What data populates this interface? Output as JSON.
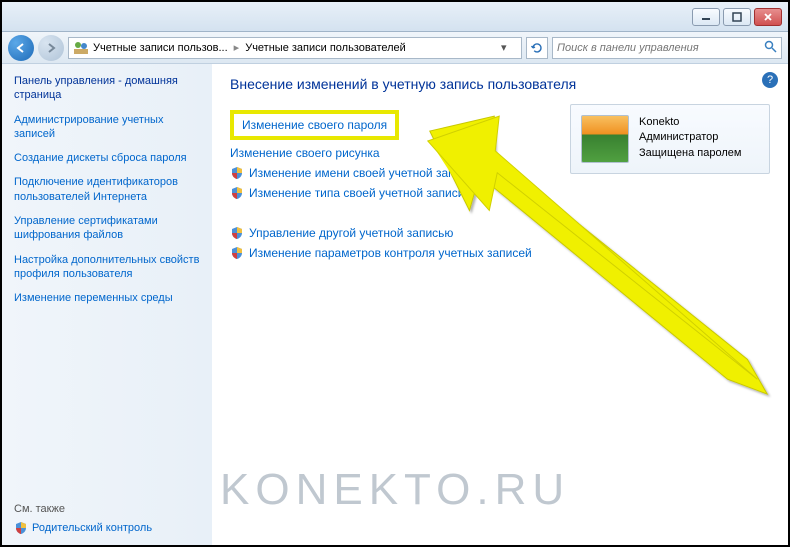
{
  "titlebar": {},
  "nav": {
    "breadcrumb_part1": "Учетные записи пользов...",
    "breadcrumb_part2": "Учетные записи пользователей",
    "search_placeholder": "Поиск в панели управления"
  },
  "sidebar": {
    "heading": "Панель управления - домашняя страница",
    "links": [
      "Администрирование учетных записей",
      "Создание дискеты сброса пароля",
      "Подключение идентификаторов пользователей Интернета",
      "Управление сертификатами шифрования файлов",
      "Настройка дополнительных свойств профиля пользователя",
      "Изменение переменных среды"
    ],
    "see_also_label": "См. также",
    "parental_label": "Родительский контроль"
  },
  "content": {
    "title": "Внесение изменений в учетную запись пользователя",
    "highlighted": "Изменение своего пароля",
    "links_plain": [
      "Изменение своего рисунка"
    ],
    "links_shield1": [
      "Изменение имени своей учетной зап",
      "Изменение типа своей учетной записи"
    ],
    "links_shield2": [
      "Управление другой учетной записью",
      "Изменение параметров контроля учетных записей"
    ]
  },
  "user": {
    "name": "Konekto",
    "role": "Администратор",
    "status": "Защищена паролем"
  },
  "watermark": "KONEKTO.RU"
}
